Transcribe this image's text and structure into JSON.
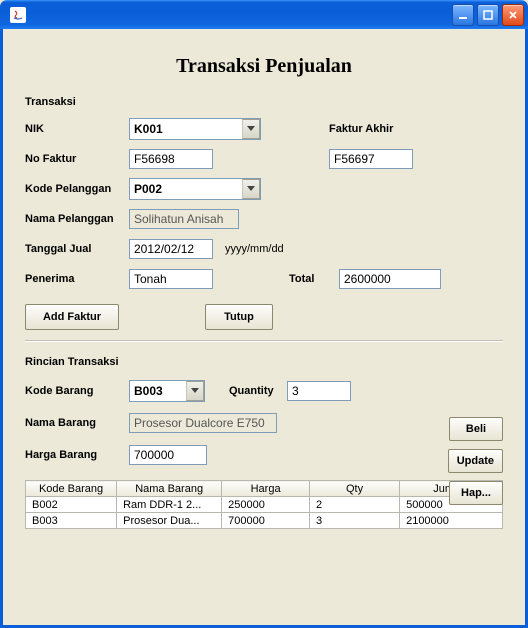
{
  "window": {
    "app_icon": "java-cup"
  },
  "page_title": "Transaksi Penjualan",
  "sections": {
    "transaksi_label": "Transaksi",
    "rincian_label": "Rincian Transaksi"
  },
  "labels": {
    "nik": "NIK",
    "no_faktur": "No Faktur",
    "faktur_akhir": "Faktur Akhir",
    "kode_pelanggan": "Kode Pelanggan",
    "nama_pelanggan": "Nama Pelanggan",
    "tanggal_jual": "Tanggal Jual",
    "tanggal_hint": "yyyy/mm/dd",
    "penerima": "Penerima",
    "total": "Total",
    "kode_barang": "Kode Barang",
    "quantity": "Quantity",
    "nama_barang": "Nama Barang",
    "harga_barang": "Harga Barang"
  },
  "buttons": {
    "add_faktur": "Add Faktur",
    "tutup": "Tutup",
    "beli": "Beli",
    "update": "Update",
    "hapus": "Hap..."
  },
  "values": {
    "nik": "K001",
    "no_faktur": "F56698",
    "faktur_akhir": "F56697",
    "kode_pelanggan": "P002",
    "nama_pelanggan": "Solihatun Anisah",
    "tanggal_jual": "2012/02/12",
    "penerima": "Tonah",
    "total": "2600000",
    "kode_barang": "B003",
    "quantity": "3",
    "nama_barang": "Prosesor Dualcore E750",
    "harga_barang": "700000"
  },
  "table": {
    "headers": {
      "kode_barang": "Kode Barang",
      "nama_barang": "Nama Barang",
      "harga": "Harga",
      "qty": "Qty",
      "jumlah": "Jumlah"
    },
    "rows": [
      {
        "kode_barang": "B002",
        "nama_barang": "Ram DDR-1 2...",
        "harga": "250000",
        "qty": "2",
        "jumlah": "500000"
      },
      {
        "kode_barang": "B003",
        "nama_barang": "Prosesor Dua...",
        "harga": "700000",
        "qty": "3",
        "jumlah": "2100000"
      }
    ]
  }
}
